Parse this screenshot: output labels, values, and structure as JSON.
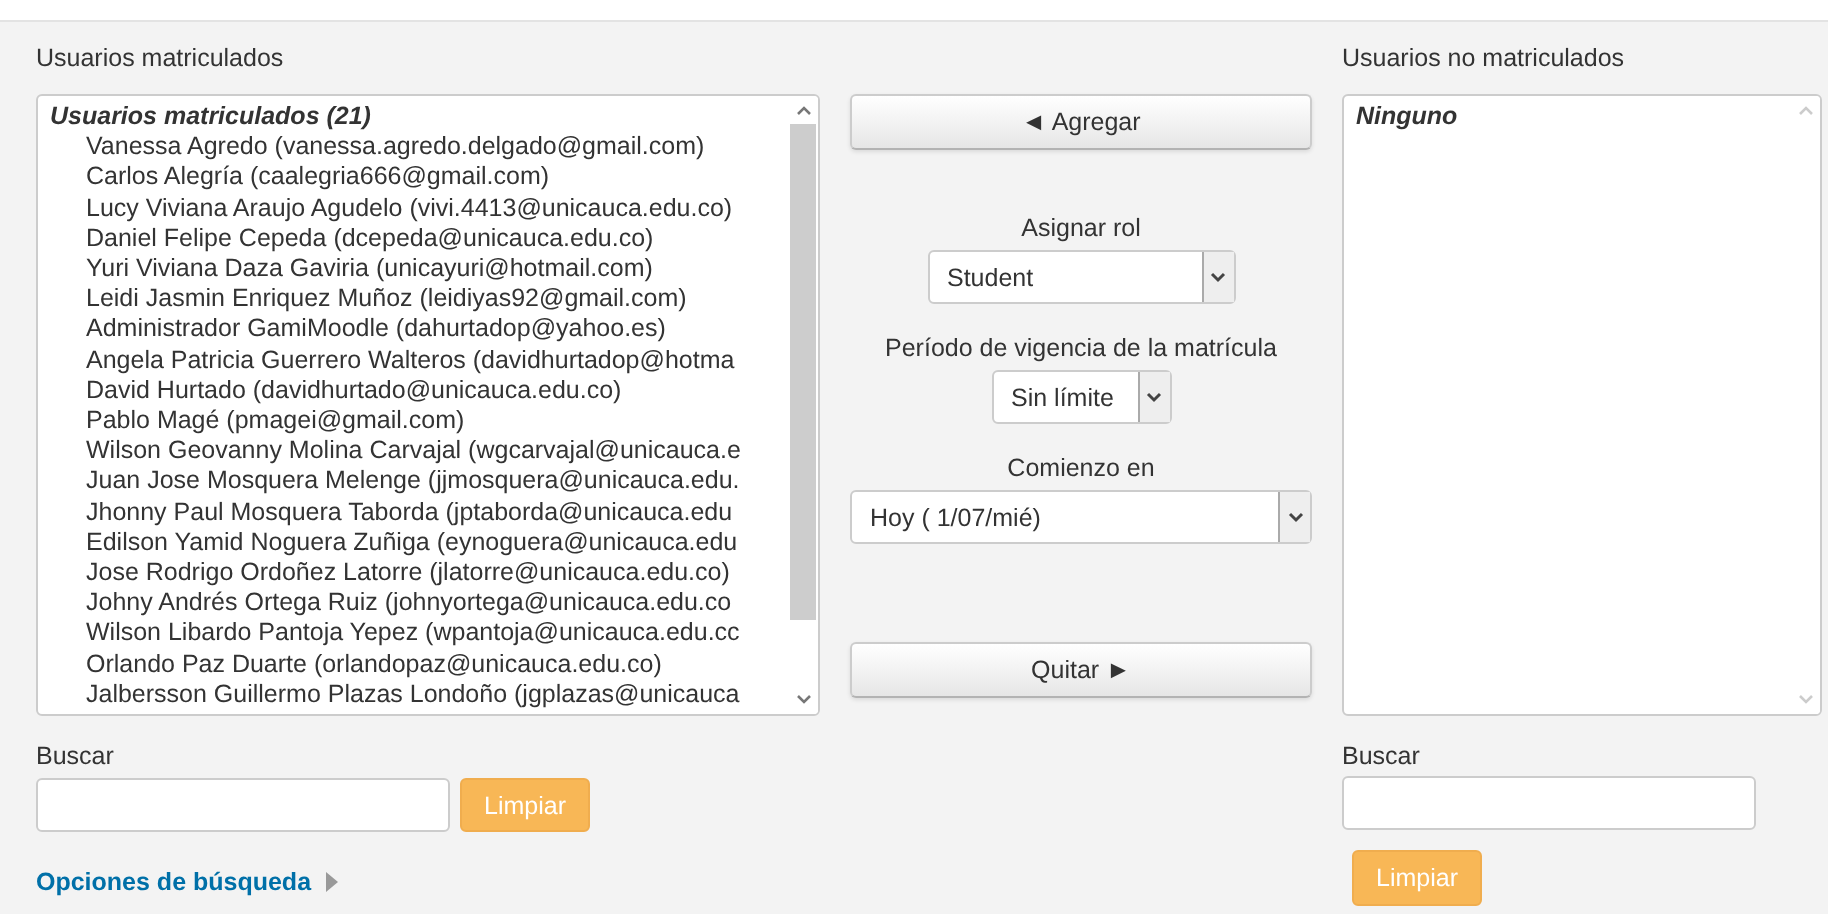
{
  "enrolled": {
    "label": "Usuarios matriculados",
    "group": "Usuarios matriculados (21)",
    "users": [
      "Vanessa Agredo (vanessa.agredo.delgado@gmail.com)",
      "Carlos Alegría (caalegria666@gmail.com)",
      "Lucy Viviana Araujo Agudelo (vivi.4413@unicauca.edu.co)",
      "Daniel Felipe Cepeda (dcepeda@unicauca.edu.co)",
      "Yuri Viviana Daza Gaviria (unicayuri@hotmail.com)",
      "Leidi Jasmin Enriquez Muñoz (leidiyas92@gmail.com)",
      "Administrador GamiMoodle (dahurtadop@yahoo.es)",
      "Angela Patricia Guerrero Walteros (davidhurtadop@hotma",
      "David Hurtado (davidhurtado@unicauca.edu.co)",
      "Pablo Magé (pmagei@gmail.com)",
      "Wilson Geovanny Molina Carvajal (wgcarvajal@unicauca.e",
      "Juan Jose Mosquera Melenge (jjmosquera@unicauca.edu.",
      "Jhonny Paul Mosquera Taborda (jptaborda@unicauca.edu",
      "Edilson Yamid Noguera Zuñiga (eynoguera@unicauca.edu",
      "Jose Rodrigo Ordoñez Latorre (jlatorre@unicauca.edu.co)",
      "Johny Andrés Ortega Ruiz (johnyortega@unicauca.edu.co",
      "Wilson Libardo Pantoja Yepez (wpantoja@unicauca.edu.cc",
      "Orlando Paz Duarte (orlandopaz@unicauca.edu.co)",
      "Jalbersson Guillermo Plazas Londoño (jgplazas@unicauca"
    ]
  },
  "actions": {
    "add": "◄ Agregar",
    "role": {
      "label": "Asignar rol",
      "value": "Student"
    },
    "duration": {
      "label": "Período de vigencia de la matrícula",
      "value": "Sin límite"
    },
    "start": {
      "label": "Comienzo en",
      "value": "Hoy ( 1/07/mié)"
    },
    "remove": "Quitar ►"
  },
  "not_enrolled": {
    "label": "Usuarios no matriculados",
    "group": "Ninguno"
  },
  "enrolled_search": {
    "label": "Buscar",
    "clear": "Limpiar"
  },
  "search_options": "Opciones de búsqueda",
  "not_enrolled_search": {
    "label": "Buscar",
    "clear": "Limpiar"
  }
}
